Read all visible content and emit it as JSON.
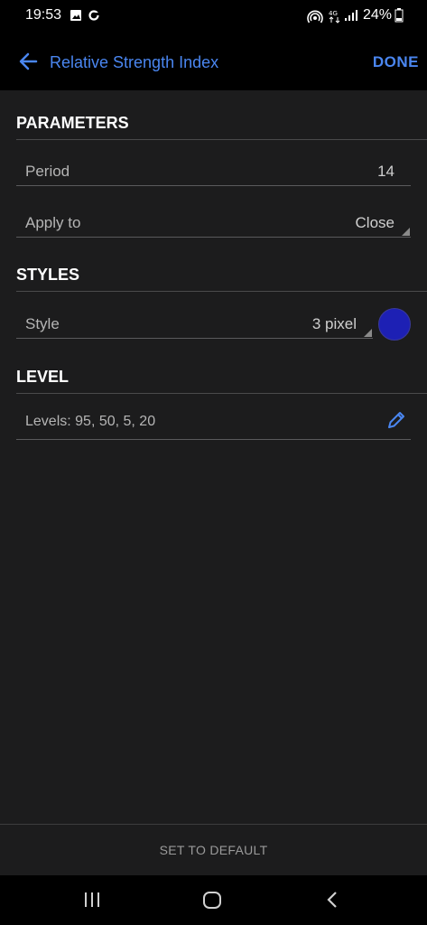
{
  "status_bar": {
    "time": "19:53",
    "battery": "24%",
    "icons": [
      "gallery-icon",
      "sync-icon",
      "hotspot-icon",
      "4g-icon",
      "signal-icon",
      "battery-icon"
    ]
  },
  "app_bar": {
    "title": "Relative Strength Index",
    "done_label": "DONE",
    "accent_color": "#4a86f0"
  },
  "parameters": {
    "header": "PARAMETERS",
    "period": {
      "label": "Period",
      "value": "14"
    },
    "apply_to": {
      "label": "Apply to",
      "value": "Close"
    }
  },
  "styles": {
    "header": "STYLES",
    "style": {
      "label": "Style",
      "value": "3 pixel"
    },
    "line_color": "#1d20b4"
  },
  "level": {
    "header": "LEVEL",
    "levels_text": "Levels:  95, 50, 5, 20"
  },
  "footer": {
    "set_default_label": "SET TO DEFAULT"
  },
  "nav_bar": {
    "icons": [
      "recents-icon",
      "home-icon",
      "back-nav-icon"
    ]
  }
}
